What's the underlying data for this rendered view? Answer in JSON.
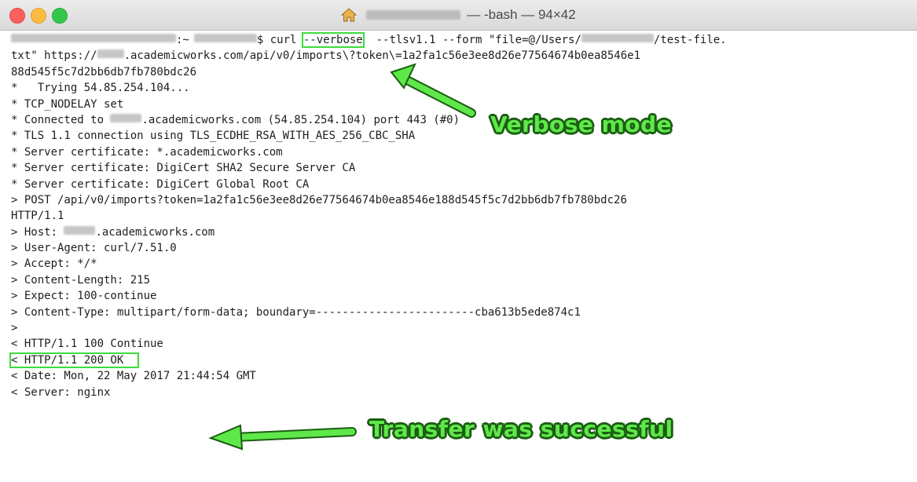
{
  "window": {
    "title": "— -bash — 94×42"
  },
  "terminal": {
    "l1_prompt_mid": ":~",
    "l1_prompt_end": "$ curl ",
    "verbose_flag": "--verbose",
    "l1_rest": "  --tlsv1.1 --form \"file=@/Users/",
    "l1_end": "/test-file.",
    "l2_a": "txt\" https://",
    "l2_b": ".academicworks.com/api/v0/imports\\?token\\=1a2fa1c56e3ee8d26e77564674b0ea8546e1",
    "l3": "88d545f5c7d2bb6db7fb780bdc26",
    "l4": "*   Trying 54.85.254.104...",
    "l5": "* TCP_NODELAY set",
    "l6_a": "* Connected to ",
    "l6_b": ".academicworks.com (54.85.254.104) port 443 (#0)",
    "l7": "* TLS 1.1 connection using TLS_ECDHE_RSA_WITH_AES_256_CBC_SHA",
    "l8": "* Server certificate: *.academicworks.com",
    "l9": "* Server certificate: DigiCert SHA2 Secure Server CA",
    "l10": "* Server certificate: DigiCert Global Root CA",
    "l11": "> POST /api/v0/imports?token=1a2fa1c56e3ee8d26e77564674b0ea8546e188d545f5c7d2bb6db7fb780bdc26",
    "l12": "HTTP/1.1",
    "l13_a": "> Host: ",
    "l13_b": ".academicworks.com",
    "l14": "> User-Agent: curl/7.51.0",
    "l15": "> Accept: */*",
    "l16": "> Content-Length: 215",
    "l17": "> Expect: 100-continue",
    "l18": "> Content-Type: multipart/form-data; boundary=------------------------cba613b5ede874c1",
    "l19": ">",
    "l20": "< HTTP/1.1 100 Continue",
    "status_ok": "< HTTP/1.1 200 OK",
    "l22": "< Date: Mon, 22 May 2017 21:44:54 GMT",
    "l23": "< Server: nginx"
  },
  "annotations": {
    "verbose": "Verbose mode",
    "success": "Transfer was successful",
    "color": "#5fe84a"
  }
}
